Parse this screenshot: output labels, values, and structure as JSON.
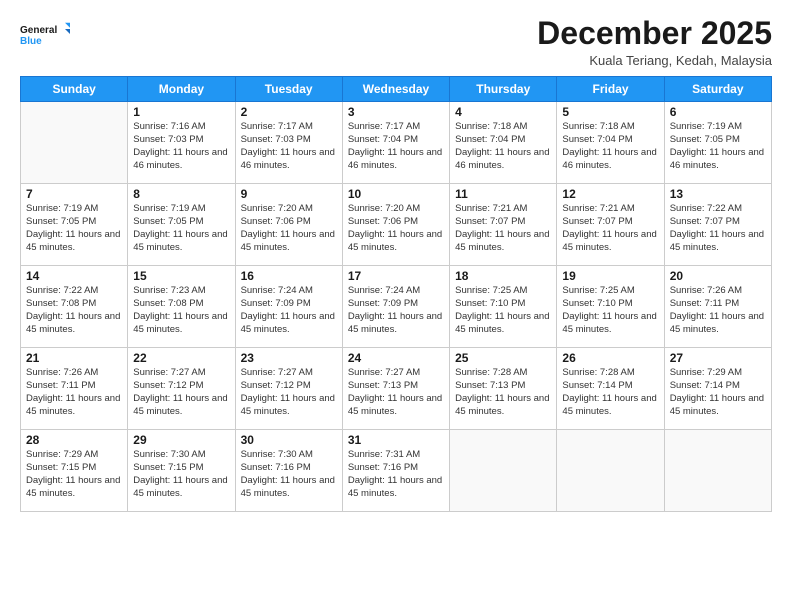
{
  "logo": {
    "line1": "General",
    "line2": "Blue"
  },
  "title": "December 2025",
  "subtitle": "Kuala Teriang, Kedah, Malaysia",
  "days_of_week": [
    "Sunday",
    "Monday",
    "Tuesday",
    "Wednesday",
    "Thursday",
    "Friday",
    "Saturday"
  ],
  "weeks": [
    [
      {
        "day": "",
        "sunrise": "",
        "sunset": "",
        "daylight": ""
      },
      {
        "day": "1",
        "sunrise": "Sunrise: 7:16 AM",
        "sunset": "Sunset: 7:03 PM",
        "daylight": "Daylight: 11 hours and 46 minutes."
      },
      {
        "day": "2",
        "sunrise": "Sunrise: 7:17 AM",
        "sunset": "Sunset: 7:03 PM",
        "daylight": "Daylight: 11 hours and 46 minutes."
      },
      {
        "day": "3",
        "sunrise": "Sunrise: 7:17 AM",
        "sunset": "Sunset: 7:04 PM",
        "daylight": "Daylight: 11 hours and 46 minutes."
      },
      {
        "day": "4",
        "sunrise": "Sunrise: 7:18 AM",
        "sunset": "Sunset: 7:04 PM",
        "daylight": "Daylight: 11 hours and 46 minutes."
      },
      {
        "day": "5",
        "sunrise": "Sunrise: 7:18 AM",
        "sunset": "Sunset: 7:04 PM",
        "daylight": "Daylight: 11 hours and 46 minutes."
      },
      {
        "day": "6",
        "sunrise": "Sunrise: 7:19 AM",
        "sunset": "Sunset: 7:05 PM",
        "daylight": "Daylight: 11 hours and 46 minutes."
      }
    ],
    [
      {
        "day": "7",
        "sunrise": "Sunrise: 7:19 AM",
        "sunset": "Sunset: 7:05 PM",
        "daylight": "Daylight: 11 hours and 45 minutes."
      },
      {
        "day": "8",
        "sunrise": "Sunrise: 7:19 AM",
        "sunset": "Sunset: 7:05 PM",
        "daylight": "Daylight: 11 hours and 45 minutes."
      },
      {
        "day": "9",
        "sunrise": "Sunrise: 7:20 AM",
        "sunset": "Sunset: 7:06 PM",
        "daylight": "Daylight: 11 hours and 45 minutes."
      },
      {
        "day": "10",
        "sunrise": "Sunrise: 7:20 AM",
        "sunset": "Sunset: 7:06 PM",
        "daylight": "Daylight: 11 hours and 45 minutes."
      },
      {
        "day": "11",
        "sunrise": "Sunrise: 7:21 AM",
        "sunset": "Sunset: 7:07 PM",
        "daylight": "Daylight: 11 hours and 45 minutes."
      },
      {
        "day": "12",
        "sunrise": "Sunrise: 7:21 AM",
        "sunset": "Sunset: 7:07 PM",
        "daylight": "Daylight: 11 hours and 45 minutes."
      },
      {
        "day": "13",
        "sunrise": "Sunrise: 7:22 AM",
        "sunset": "Sunset: 7:07 PM",
        "daylight": "Daylight: 11 hours and 45 minutes."
      }
    ],
    [
      {
        "day": "14",
        "sunrise": "Sunrise: 7:22 AM",
        "sunset": "Sunset: 7:08 PM",
        "daylight": "Daylight: 11 hours and 45 minutes."
      },
      {
        "day": "15",
        "sunrise": "Sunrise: 7:23 AM",
        "sunset": "Sunset: 7:08 PM",
        "daylight": "Daylight: 11 hours and 45 minutes."
      },
      {
        "day": "16",
        "sunrise": "Sunrise: 7:24 AM",
        "sunset": "Sunset: 7:09 PM",
        "daylight": "Daylight: 11 hours and 45 minutes."
      },
      {
        "day": "17",
        "sunrise": "Sunrise: 7:24 AM",
        "sunset": "Sunset: 7:09 PM",
        "daylight": "Daylight: 11 hours and 45 minutes."
      },
      {
        "day": "18",
        "sunrise": "Sunrise: 7:25 AM",
        "sunset": "Sunset: 7:10 PM",
        "daylight": "Daylight: 11 hours and 45 minutes."
      },
      {
        "day": "19",
        "sunrise": "Sunrise: 7:25 AM",
        "sunset": "Sunset: 7:10 PM",
        "daylight": "Daylight: 11 hours and 45 minutes."
      },
      {
        "day": "20",
        "sunrise": "Sunrise: 7:26 AM",
        "sunset": "Sunset: 7:11 PM",
        "daylight": "Daylight: 11 hours and 45 minutes."
      }
    ],
    [
      {
        "day": "21",
        "sunrise": "Sunrise: 7:26 AM",
        "sunset": "Sunset: 7:11 PM",
        "daylight": "Daylight: 11 hours and 45 minutes."
      },
      {
        "day": "22",
        "sunrise": "Sunrise: 7:27 AM",
        "sunset": "Sunset: 7:12 PM",
        "daylight": "Daylight: 11 hours and 45 minutes."
      },
      {
        "day": "23",
        "sunrise": "Sunrise: 7:27 AM",
        "sunset": "Sunset: 7:12 PM",
        "daylight": "Daylight: 11 hours and 45 minutes."
      },
      {
        "day": "24",
        "sunrise": "Sunrise: 7:27 AM",
        "sunset": "Sunset: 7:13 PM",
        "daylight": "Daylight: 11 hours and 45 minutes."
      },
      {
        "day": "25",
        "sunrise": "Sunrise: 7:28 AM",
        "sunset": "Sunset: 7:13 PM",
        "daylight": "Daylight: 11 hours and 45 minutes."
      },
      {
        "day": "26",
        "sunrise": "Sunrise: 7:28 AM",
        "sunset": "Sunset: 7:14 PM",
        "daylight": "Daylight: 11 hours and 45 minutes."
      },
      {
        "day": "27",
        "sunrise": "Sunrise: 7:29 AM",
        "sunset": "Sunset: 7:14 PM",
        "daylight": "Daylight: 11 hours and 45 minutes."
      }
    ],
    [
      {
        "day": "28",
        "sunrise": "Sunrise: 7:29 AM",
        "sunset": "Sunset: 7:15 PM",
        "daylight": "Daylight: 11 hours and 45 minutes."
      },
      {
        "day": "29",
        "sunrise": "Sunrise: 7:30 AM",
        "sunset": "Sunset: 7:15 PM",
        "daylight": "Daylight: 11 hours and 45 minutes."
      },
      {
        "day": "30",
        "sunrise": "Sunrise: 7:30 AM",
        "sunset": "Sunset: 7:16 PM",
        "daylight": "Daylight: 11 hours and 45 minutes."
      },
      {
        "day": "31",
        "sunrise": "Sunrise: 7:31 AM",
        "sunset": "Sunset: 7:16 PM",
        "daylight": "Daylight: 11 hours and 45 minutes."
      },
      {
        "day": "",
        "sunrise": "",
        "sunset": "",
        "daylight": ""
      },
      {
        "day": "",
        "sunrise": "",
        "sunset": "",
        "daylight": ""
      },
      {
        "day": "",
        "sunrise": "",
        "sunset": "",
        "daylight": ""
      }
    ]
  ]
}
